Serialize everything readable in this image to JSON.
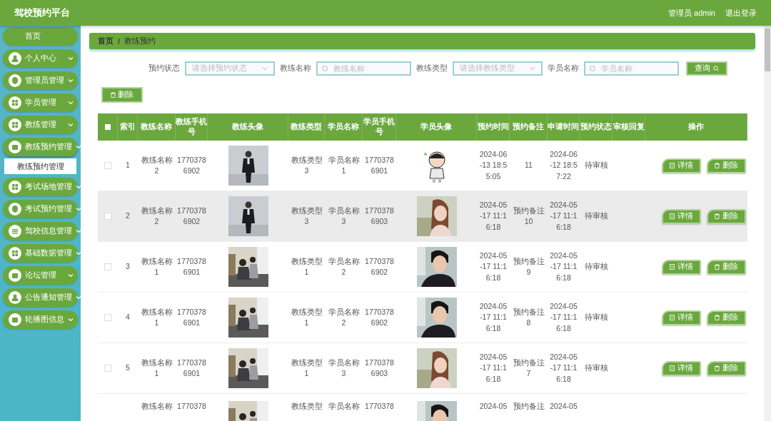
{
  "header": {
    "title": "驾校预约平台",
    "user": "管理员 admin",
    "logout": "退出登录"
  },
  "sidebar": {
    "items": [
      {
        "label": "首页",
        "kind": "home"
      },
      {
        "label": "个人中心",
        "kind": "menu"
      },
      {
        "label": "管理员管理",
        "kind": "menu"
      },
      {
        "label": "学员管理",
        "kind": "menu"
      },
      {
        "label": "教练管理",
        "kind": "menu"
      },
      {
        "label": "教练预约管理",
        "kind": "menu",
        "expanded": true,
        "children": [
          {
            "label": "教练预约管理",
            "selected": true
          }
        ]
      },
      {
        "label": "考试场地管理",
        "kind": "menu"
      },
      {
        "label": "考试预约管理",
        "kind": "menu"
      },
      {
        "label": "驾校信息管理",
        "kind": "menu"
      },
      {
        "label": "基础数据管理",
        "kind": "menu"
      },
      {
        "label": "论坛管理",
        "kind": "menu"
      },
      {
        "label": "公告通知管理",
        "kind": "menu"
      },
      {
        "label": "轮播图信息",
        "kind": "menu"
      }
    ]
  },
  "breadcrumb": {
    "items": [
      "首页",
      "教练预约"
    ],
    "separator": "/"
  },
  "search": {
    "fields": [
      {
        "label": "预约状态",
        "kind": "select",
        "placeholder": "请选择预约状态"
      },
      {
        "label": "教练名称",
        "kind": "input",
        "placeholder": "教练名称"
      },
      {
        "label": "教练类型",
        "kind": "select",
        "placeholder": "请选择教练类型"
      },
      {
        "label": "学员名称",
        "kind": "input",
        "placeholder": "学员名称"
      }
    ],
    "button": "查询"
  },
  "delete_button": "删除",
  "table": {
    "select_all_checked": false,
    "columns": [
      "索引",
      "教练名称",
      "教练手机号",
      "教练头像",
      "教练类型",
      "学员名称",
      "学员手机号",
      "学员头像",
      "预约时间",
      "预约备注",
      "申请时间",
      "预约状态",
      "审核回复",
      "操作"
    ],
    "rows": [
      {
        "checked": false,
        "hovered": false,
        "index": "1",
        "coach": "教练名称2",
        "coach_phone": "17703786902",
        "coach_photo": {
          "kind": "picture"
        },
        "coach_type": "教练类型3",
        "student": "学员名称1",
        "student_phone": "17703786901",
        "student_photo": {
          "kind": "picture"
        },
        "time": "2024-06-13 18:55:05",
        "note": "11",
        "applied": "2024-06-12 18:57:22",
        "status": "待审核",
        "actions": [
          {
            "label": "详情",
            "kind": "detail"
          },
          {
            "label": "删除",
            "kind": "delete"
          }
        ]
      },
      {
        "checked": false,
        "hovered": true,
        "index": "2",
        "coach": "教练名称2",
        "coach_phone": "17703786902",
        "coach_photo": {
          "kind": "picture"
        },
        "coach_type": "教练类型3",
        "student": "学员名称3",
        "student_phone": "17703786903",
        "student_photo": {
          "kind": "picture"
        },
        "time": "2024-05-17 11:16:18",
        "note": "预约备注10",
        "applied": "2024-05-17 11:16:18",
        "status": "待审核",
        "actions": [
          {
            "label": "详情",
            "kind": "detail"
          },
          {
            "label": "删除",
            "kind": "delete"
          }
        ]
      },
      {
        "checked": false,
        "hovered": false,
        "index": "3",
        "coach": "教练名称1",
        "coach_phone": "17703786901",
        "coach_photo": {
          "kind": "picture"
        },
        "coach_type": "教练类型1",
        "student": "学员名称2",
        "student_phone": "17703786902",
        "student_photo": {
          "kind": "picture"
        },
        "time": "2024-05-17 11:16:18",
        "note": "预约备注9",
        "applied": "2024-05-17 11:16:18",
        "status": "待审核",
        "actions": [
          {
            "label": "详情",
            "kind": "detail"
          },
          {
            "label": "删除",
            "kind": "delete"
          }
        ]
      },
      {
        "checked": false,
        "hovered": false,
        "index": "4",
        "coach": "教练名称1",
        "coach_phone": "17703786901",
        "coach_photo": {
          "kind": "picture"
        },
        "coach_type": "教练类型1",
        "student": "学员名称2",
        "student_phone": "17703786902",
        "student_photo": {
          "kind": "picture"
        },
        "time": "2024-05-17 11:16:18",
        "note": "预约备注8",
        "applied": "2024-05-17 11:16:18",
        "status": "待审核",
        "actions": [
          {
            "label": "详情",
            "kind": "detail"
          },
          {
            "label": "删除",
            "kind": "delete"
          }
        ]
      },
      {
        "checked": false,
        "hovered": false,
        "index": "5",
        "coach": "教练名称1",
        "coach_phone": "17703786901",
        "coach_photo": {
          "kind": "picture"
        },
        "coach_type": "教练类型1",
        "student": "学员名称3",
        "student_phone": "17703786903",
        "student_photo": {
          "kind": "picture"
        },
        "time": "2024-05-17 11:16:18",
        "note": "预约备注7",
        "applied": "2024-05-17 11:16:18",
        "status": "待审核",
        "actions": [
          {
            "label": "详情",
            "kind": "detail"
          },
          {
            "label": "删除",
            "kind": "delete"
          }
        ]
      },
      {
        "hovered": false,
        "coach": "教练名称",
        "coach_phone": "1770378",
        "coach_photo": {
          "kind": "picture"
        },
        "coach_type": "教练类型",
        "student": "学员名称",
        "student_phone": "1770378",
        "student_photo": {
          "kind": "picture"
        },
        "time": "2024-05",
        "note": "预约备注",
        "applied": "2024-05"
      }
    ]
  }
}
